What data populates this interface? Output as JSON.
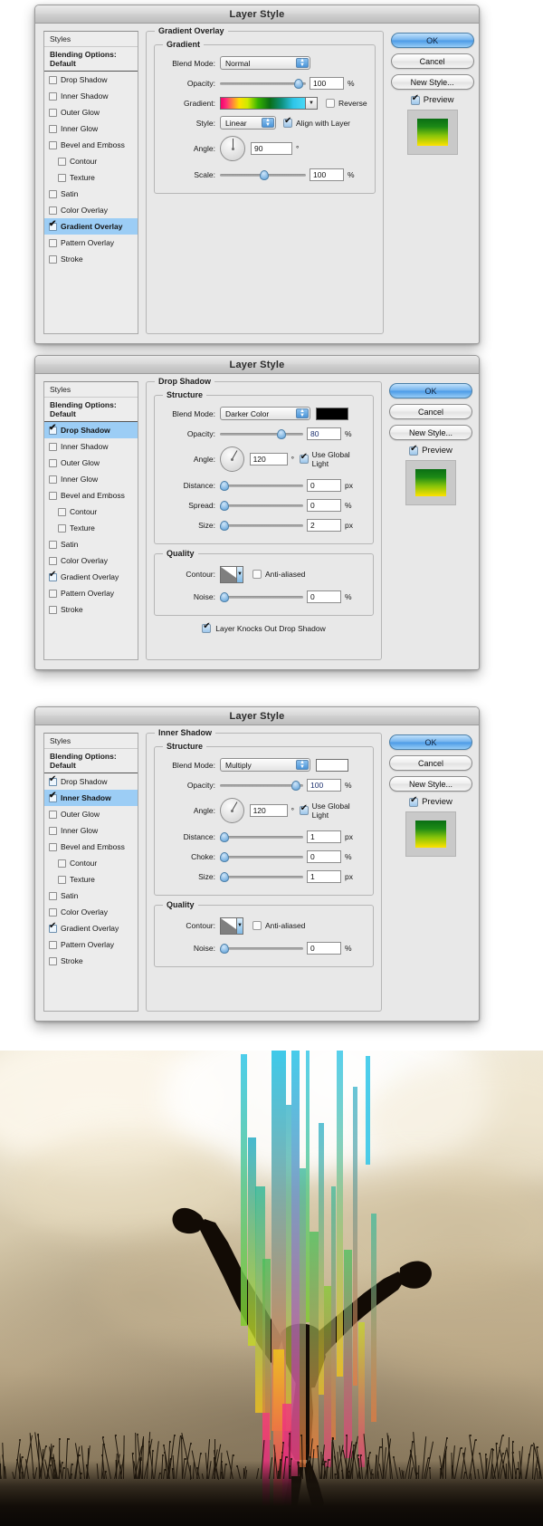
{
  "dialogs": [
    {
      "id": "gradient-overlay",
      "title": "Layer Style",
      "styles_panel": {
        "header": "Styles",
        "blending_options": "Blending Options: Default",
        "items": [
          {
            "label": "Drop Shadow",
            "checked": false,
            "indent": false,
            "selected": false
          },
          {
            "label": "Inner Shadow",
            "checked": false,
            "indent": false,
            "selected": false
          },
          {
            "label": "Outer Glow",
            "checked": false,
            "indent": false,
            "selected": false
          },
          {
            "label": "Inner Glow",
            "checked": false,
            "indent": false,
            "selected": false
          },
          {
            "label": "Bevel and Emboss",
            "checked": false,
            "indent": false,
            "selected": false
          },
          {
            "label": "Contour",
            "checked": false,
            "indent": true,
            "selected": false
          },
          {
            "label": "Texture",
            "checked": false,
            "indent": true,
            "selected": false
          },
          {
            "label": "Satin",
            "checked": false,
            "indent": false,
            "selected": false
          },
          {
            "label": "Color Overlay",
            "checked": false,
            "indent": false,
            "selected": false
          },
          {
            "label": "Gradient Overlay",
            "checked": true,
            "indent": false,
            "selected": true
          },
          {
            "label": "Pattern Overlay",
            "checked": false,
            "indent": false,
            "selected": false
          },
          {
            "label": "Stroke",
            "checked": false,
            "indent": false,
            "selected": false
          }
        ]
      },
      "outer_group": "Gradient Overlay",
      "inner_group": "Gradient",
      "fields": {
        "blend_mode_label": "Blend Mode:",
        "blend_mode_value": "Normal",
        "opacity_label": "Opacity:",
        "opacity_value": "100",
        "opacity_unit": "%",
        "gradient_label": "Gradient:",
        "reverse_label": "Reverse",
        "reverse_checked": false,
        "style_label": "Style:",
        "style_value": "Linear",
        "align_label": "Align with Layer",
        "align_checked": true,
        "angle_label": "Angle:",
        "angle_value": "90",
        "angle_unit": "°",
        "scale_label": "Scale:",
        "scale_value": "100",
        "scale_unit": "%"
      },
      "buttons": {
        "ok": "OK",
        "cancel": "Cancel",
        "new_style": "New Style...",
        "preview": "Preview",
        "preview_checked": true
      }
    },
    {
      "id": "drop-shadow",
      "title": "Layer Style",
      "styles_panel": {
        "header": "Styles",
        "blending_options": "Blending Options: Default",
        "items": [
          {
            "label": "Drop Shadow",
            "checked": true,
            "indent": false,
            "selected": true
          },
          {
            "label": "Inner Shadow",
            "checked": false,
            "indent": false,
            "selected": false
          },
          {
            "label": "Outer Glow",
            "checked": false,
            "indent": false,
            "selected": false
          },
          {
            "label": "Inner Glow",
            "checked": false,
            "indent": false,
            "selected": false
          },
          {
            "label": "Bevel and Emboss",
            "checked": false,
            "indent": false,
            "selected": false
          },
          {
            "label": "Contour",
            "checked": false,
            "indent": true,
            "selected": false
          },
          {
            "label": "Texture",
            "checked": false,
            "indent": true,
            "selected": false
          },
          {
            "label": "Satin",
            "checked": false,
            "indent": false,
            "selected": false
          },
          {
            "label": "Color Overlay",
            "checked": false,
            "indent": false,
            "selected": false
          },
          {
            "label": "Gradient Overlay",
            "checked": true,
            "indent": false,
            "selected": false
          },
          {
            "label": "Pattern Overlay",
            "checked": false,
            "indent": false,
            "selected": false
          },
          {
            "label": "Stroke",
            "checked": false,
            "indent": false,
            "selected": false
          }
        ]
      },
      "outer_group": "Drop Shadow",
      "inner_group": "Structure",
      "quality_group": "Quality",
      "fields": {
        "blend_mode_label": "Blend Mode:",
        "blend_mode_value": "Darker Color",
        "color_swatch": "#000000",
        "opacity_label": "Opacity:",
        "opacity_value": "80",
        "opacity_unit": "%",
        "angle_label": "Angle:",
        "angle_value": "120",
        "angle_unit": "°",
        "global_light_label": "Use Global Light",
        "global_light_checked": true,
        "distance_label": "Distance:",
        "distance_value": "0",
        "distance_unit": "px",
        "spread_label": "Spread:",
        "spread_value": "0",
        "spread_unit": "%",
        "size_label": "Size:",
        "size_value": "2",
        "size_unit": "px",
        "contour_label": "Contour:",
        "antialiased_label": "Anti-aliased",
        "antialiased_checked": false,
        "noise_label": "Noise:",
        "noise_value": "0",
        "noise_unit": "%",
        "knockout_label": "Layer Knocks Out Drop Shadow",
        "knockout_checked": true
      },
      "buttons": {
        "ok": "OK",
        "cancel": "Cancel",
        "new_style": "New Style...",
        "preview": "Preview",
        "preview_checked": true
      }
    },
    {
      "id": "inner-shadow",
      "title": "Layer Style",
      "styles_panel": {
        "header": "Styles",
        "blending_options": "Blending Options: Default",
        "items": [
          {
            "label": "Drop Shadow",
            "checked": true,
            "indent": false,
            "selected": false
          },
          {
            "label": "Inner Shadow",
            "checked": true,
            "indent": false,
            "selected": true
          },
          {
            "label": "Outer Glow",
            "checked": false,
            "indent": false,
            "selected": false
          },
          {
            "label": "Inner Glow",
            "checked": false,
            "indent": false,
            "selected": false
          },
          {
            "label": "Bevel and Emboss",
            "checked": false,
            "indent": false,
            "selected": false
          },
          {
            "label": "Contour",
            "checked": false,
            "indent": true,
            "selected": false
          },
          {
            "label": "Texture",
            "checked": false,
            "indent": true,
            "selected": false
          },
          {
            "label": "Satin",
            "checked": false,
            "indent": false,
            "selected": false
          },
          {
            "label": "Color Overlay",
            "checked": false,
            "indent": false,
            "selected": false
          },
          {
            "label": "Gradient Overlay",
            "checked": true,
            "indent": false,
            "selected": false
          },
          {
            "label": "Pattern Overlay",
            "checked": false,
            "indent": false,
            "selected": false
          },
          {
            "label": "Stroke",
            "checked": false,
            "indent": false,
            "selected": false
          }
        ]
      },
      "outer_group": "Inner Shadow",
      "inner_group": "Structure",
      "quality_group": "Quality",
      "fields": {
        "blend_mode_label": "Blend Mode:",
        "blend_mode_value": "Multiply",
        "color_swatch": "#ffffff",
        "opacity_label": "Opacity:",
        "opacity_value": "100",
        "opacity_unit": "%",
        "angle_label": "Angle:",
        "angle_value": "120",
        "angle_unit": "°",
        "global_light_label": "Use Global Light",
        "global_light_checked": true,
        "distance_label": "Distance:",
        "distance_value": "1",
        "distance_unit": "px",
        "choke_label": "Choke:",
        "choke_value": "0",
        "choke_unit": "%",
        "size_label": "Size:",
        "size_value": "1",
        "size_unit": "px",
        "contour_label": "Contour:",
        "antialiased_label": "Anti-aliased",
        "antialiased_checked": false,
        "noise_label": "Noise:",
        "noise_value": "0",
        "noise_unit": "%"
      },
      "buttons": {
        "ok": "OK",
        "cancel": "Cancel",
        "new_style": "New Style...",
        "preview": "Preview",
        "preview_checked": true
      }
    }
  ],
  "artwork": {
    "description": "Sepia photo of a person doing a handstand in a field with colorful vertical stripes",
    "stripe_colors": [
      "#2ec5e8",
      "#1aa8c4",
      "#2bb89a",
      "#46c05a",
      "#7fcb2a",
      "#c6d81e",
      "#f2c41a",
      "#f07a3a",
      "#ef3b7d",
      "#e8127a"
    ],
    "sky_tone": "#cfc1a2",
    "ground_tone": "#120d08"
  }
}
